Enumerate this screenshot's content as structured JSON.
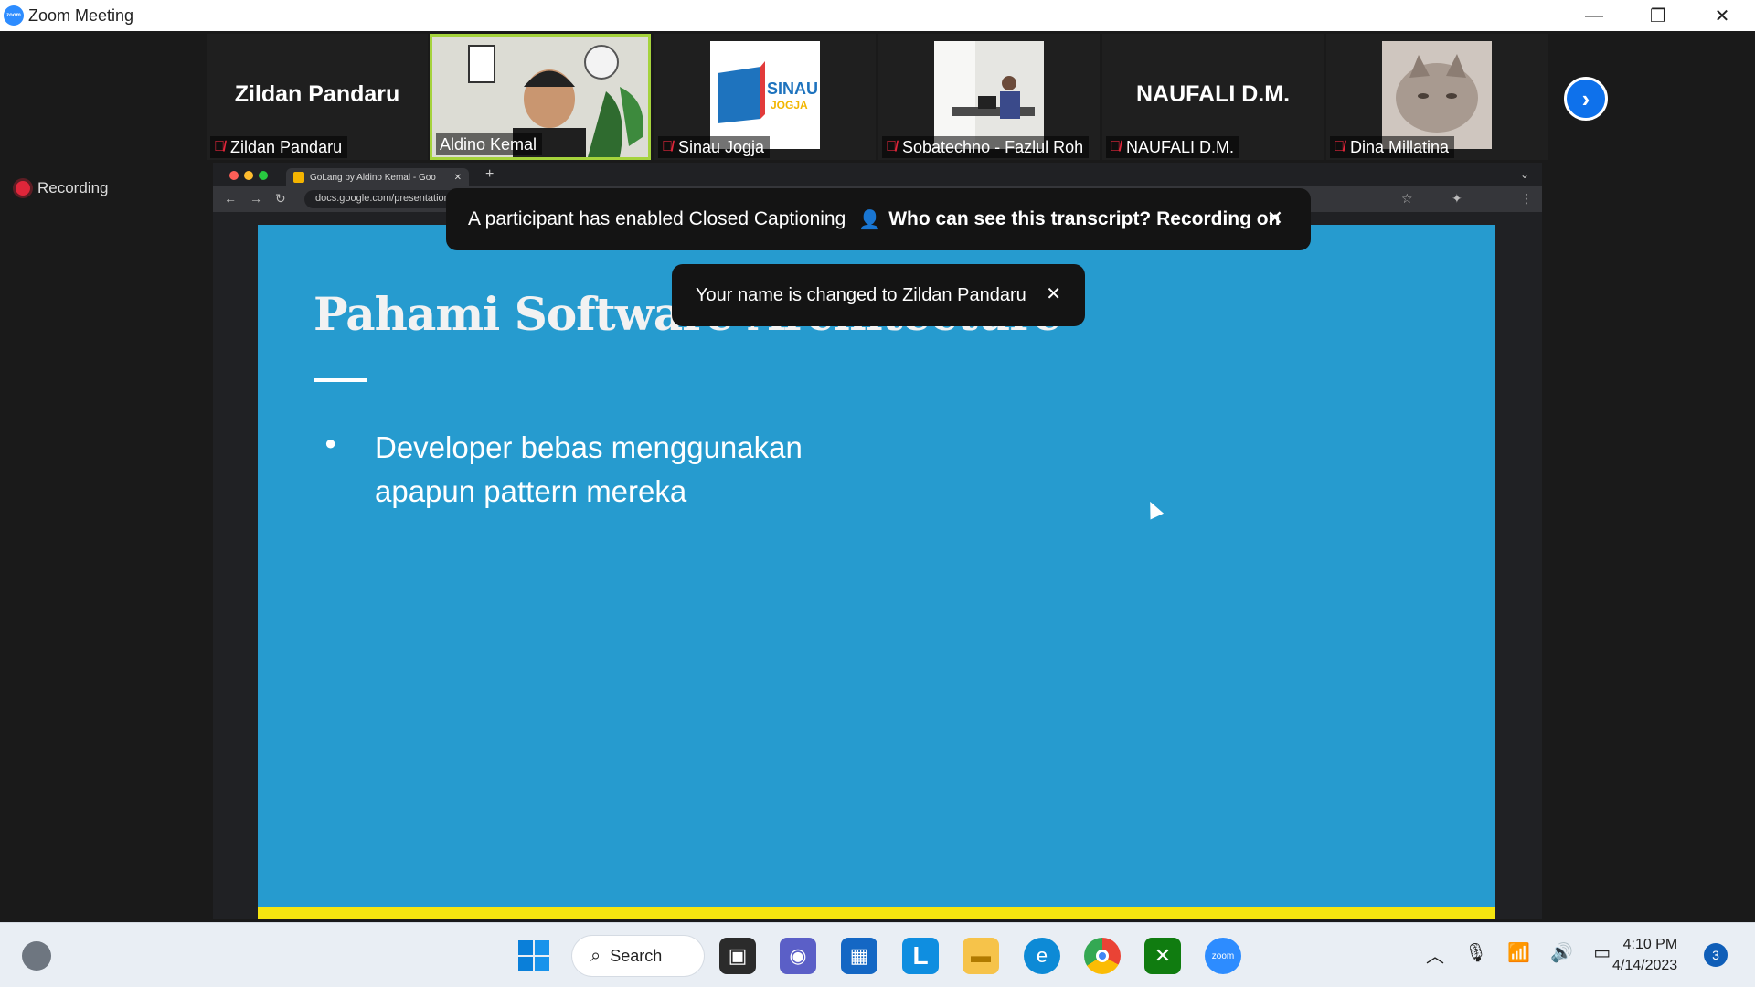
{
  "window": {
    "title": "Zoom Meeting",
    "app_icon_text": "zoom",
    "minimize": "—",
    "restore": "❐",
    "close": "✕"
  },
  "participants": [
    {
      "name": "Zildan Pandaru",
      "display": "Zildan Pandaru",
      "muted": true,
      "video": false
    },
    {
      "name": "Aldino Kemal",
      "muted": false,
      "video": true,
      "active_speaker": true
    },
    {
      "name": "Sinau Jogja",
      "muted": true,
      "video": true,
      "logo_text": "SINAU",
      "logo_sub": "JOGJA"
    },
    {
      "name": "Sobatechno - Fazlul Roh",
      "muted": true,
      "video": true
    },
    {
      "name": "NAUFALI D.M.",
      "display": "NAUFALI D.M.",
      "muted": true,
      "video": false
    },
    {
      "name": "Dina Millatina",
      "muted": true,
      "video": true
    }
  ],
  "recording": {
    "label": "Recording"
  },
  "browser": {
    "tab_title": "GoLang by Aldino Kemal - Goo",
    "url": "docs.google.com/presentation/d/1k-1Yj9ghsJ/edit#slide=id.p"
  },
  "slide": {
    "title": "Pahami Software Architecture",
    "bullet_line1": "Developer bebas menggunakan",
    "bullet_line2": "apapun pattern mereka"
  },
  "notifications": {
    "cc_message": "A participant has enabled Closed Captioning",
    "cc_question": "Who can see this transcript? Recording on",
    "name_change": "Your name is changed to Zildan Pandaru"
  },
  "taskbar": {
    "search_label": "Search",
    "time": "4:10 PM",
    "date": "4/14/2023",
    "notification_count": "3",
    "zoom_label": "zoom"
  }
}
